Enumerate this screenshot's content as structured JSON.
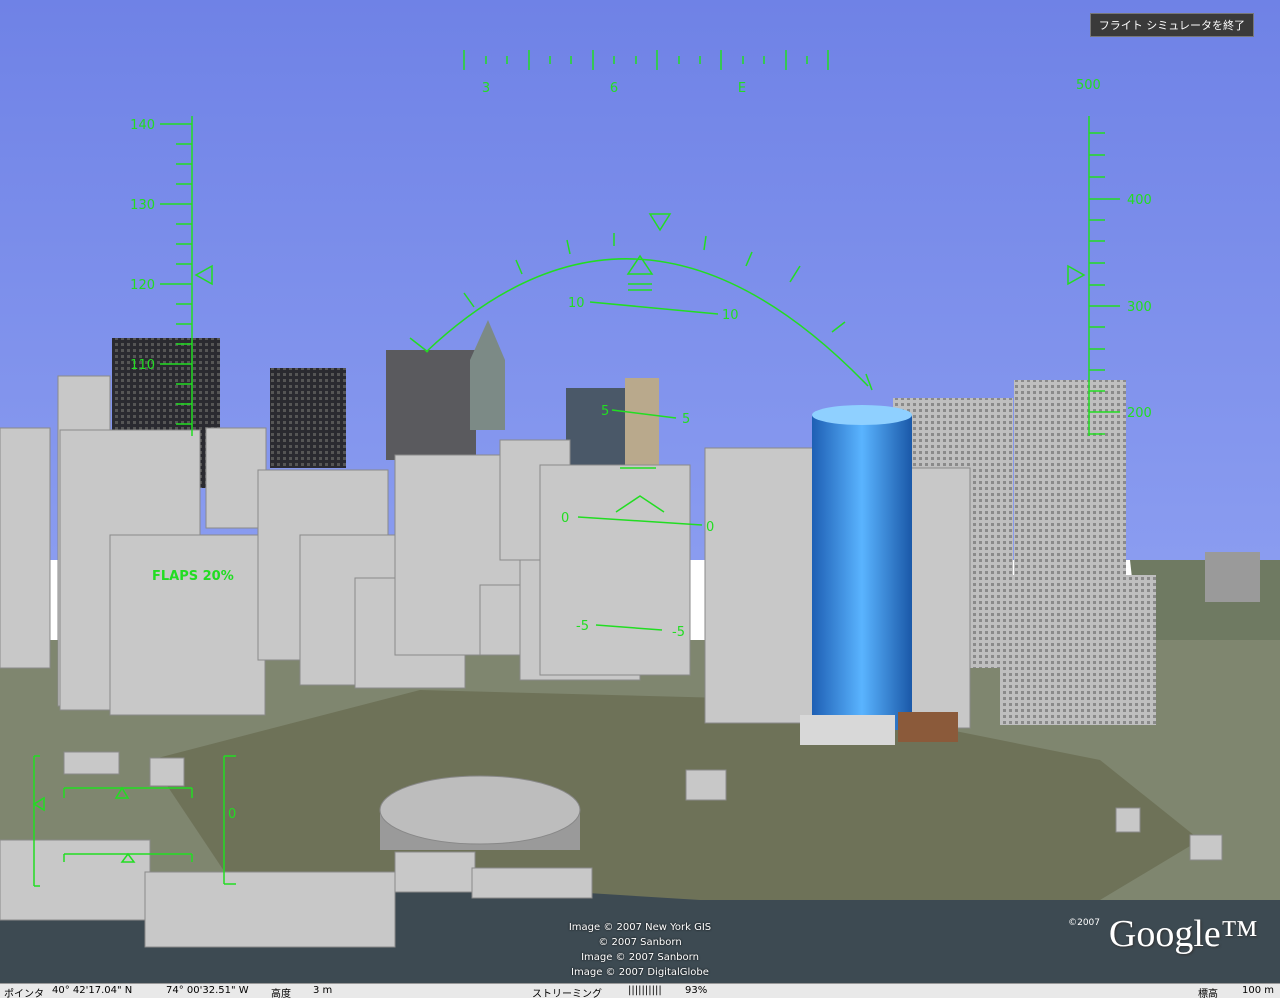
{
  "exit_button": "フライト シミュレータを終了",
  "hud": {
    "heading_labels": [
      "3",
      "6",
      "E"
    ],
    "speed_labels": [
      "140",
      "130",
      "120",
      "110"
    ],
    "altitude_labels": [
      "500",
      "400",
      "300",
      "200"
    ],
    "pitch_labels": {
      "p10": "10",
      "p5": "5",
      "p0": "0",
      "m5": "-5"
    },
    "flaps": "FLAPS 20%",
    "trim_label": "0",
    "color": "#22dd22"
  },
  "copyright": [
    "Image © 2007 New York GIS",
    "© 2007 Sanborn",
    "Image © 2007 Sanborn",
    "Image © 2007 DigitalGlobe"
  ],
  "logo": {
    "copyright": "©2007",
    "text": "Google™"
  },
  "status": {
    "pointer": "ポインタ",
    "lat": "40° 42'17.04\" N",
    "lon": "74° 00'32.51\" W",
    "elev_label": "高度",
    "elev": "3 m",
    "streaming_label": "ストリーミング",
    "streaming_bars": "||||||||||",
    "streaming_pct": "93%",
    "eye_label": "標高",
    "eye": "100 m"
  }
}
